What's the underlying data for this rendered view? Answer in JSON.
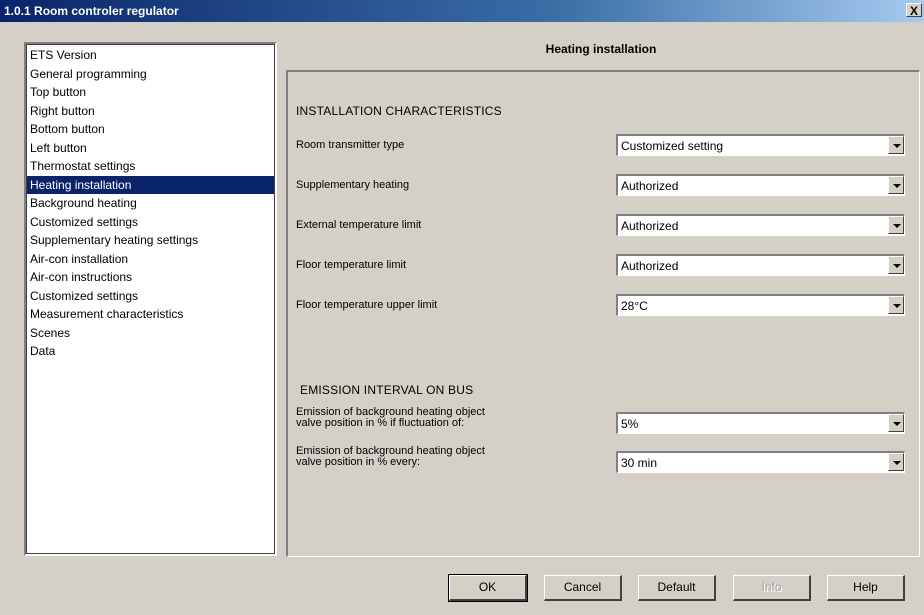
{
  "window": {
    "title": "1.0.1 Room controler regulator",
    "close_label": "X"
  },
  "nav": {
    "items": [
      {
        "label": "ETS Version"
      },
      {
        "label": "General programming"
      },
      {
        "label": "Top button"
      },
      {
        "label": "Right button"
      },
      {
        "label": "Bottom button"
      },
      {
        "label": "Left button"
      },
      {
        "label": "Thermostat settings"
      },
      {
        "label": "Heating installation",
        "selected": true
      },
      {
        "label": "Background heating"
      },
      {
        "label": "Customized settings"
      },
      {
        "label": "Supplementary heating settings"
      },
      {
        "label": "Air-con installation"
      },
      {
        "label": "Air-con instructions"
      },
      {
        "label": "Customized settings"
      },
      {
        "label": "Measurement characteristics"
      },
      {
        "label": "Scenes"
      },
      {
        "label": "Data"
      }
    ]
  },
  "panel": {
    "title": "Heating installation",
    "section1": "INSTALLATION CHARACTERISTICS",
    "section2": "EMISSION INTERVAL ON BUS",
    "fields": [
      {
        "label": "Room transmitter type",
        "value": "Customized setting"
      },
      {
        "label": "Supplementary heating",
        "value": "Authorized"
      },
      {
        "label": "External temperature limit",
        "value": "Authorized"
      },
      {
        "label": "Floor temperature limit",
        "value": "Authorized"
      },
      {
        "label": "Floor temperature upper limit",
        "value": "28°C"
      }
    ],
    "emission": [
      {
        "label_line1": "Emission of background heating object",
        "label_line2": "valve position in % if fluctuation of:",
        "value": "5%"
      },
      {
        "label_line1": "Emission of background heating object",
        "label_line2": "valve position in % every:",
        "value": "30 min"
      }
    ]
  },
  "buttons": {
    "ok": "OK",
    "cancel": "Cancel",
    "default": "Default",
    "info": "Info",
    "help": "Help"
  }
}
